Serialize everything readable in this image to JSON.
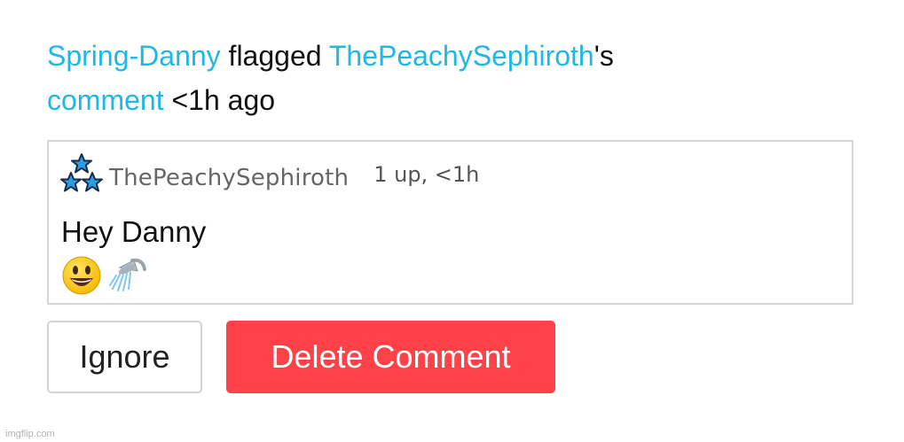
{
  "notification": {
    "actor": "Spring-Danny",
    "action": "flagged",
    "target_user": "ThePeachySephiroth",
    "possessive": "'s",
    "object": "comment",
    "time": "<1h ago"
  },
  "comment": {
    "username": "ThePeachySephiroth",
    "meta": "1 up, <1h",
    "text": "Hey Danny",
    "emojis": [
      "smiley-face-emoji",
      "shower-emoji"
    ]
  },
  "buttons": {
    "ignore": "Ignore",
    "delete": "Delete Comment"
  },
  "colors": {
    "link": "#1fb8e6",
    "delete_button": "#ff4248",
    "border": "#d6d6d6"
  },
  "watermark": "imgflip.com"
}
